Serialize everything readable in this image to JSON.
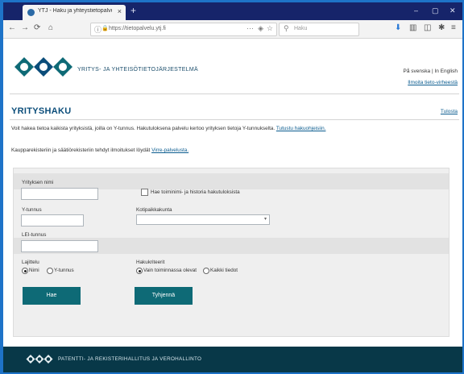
{
  "browser": {
    "tab_title": "YTJ - Haku ja yhteystietopalvelu",
    "tab_close": "×",
    "new_tab": "+",
    "window_controls": [
      "–",
      "▢",
      "✕"
    ],
    "url": "https://tietopalvelu.ytj.fi",
    "search_placeholder": "Haku",
    "nav": {
      "back": "←",
      "forward": "→",
      "reload": "⟳",
      "home": "⌂",
      "more": "···",
      "download": "⬇",
      "library": "▥",
      "sidebar": "◫",
      "menu": "≡"
    }
  },
  "header": {
    "brand": "YRITYS- JA YHTEISÖTIETOJÄRJESTELMÄ",
    "languages": "På svenska  |  In English",
    "contact_link": "Ilmoita tieto-virheestä"
  },
  "main": {
    "title": "YRITYSHAKU",
    "help_link": "Tulosta",
    "intro_text": "Voit hakea tietoa kaikista yrityksistä, joilla on Y-tunnus. Hakutuloksena palvelu kertoo yrityksen tietoja Y-tunnukselta.",
    "intro_link": "Tutustu hakuohjeisiin.",
    "trade_text": "Kaupparekisteriin ja säätiörekisteriin tehdyt ilmoitukset löydät",
    "trade_link": "Virre-palvelusta."
  },
  "form": {
    "name_label": "Yrityksen nimi",
    "name_value": "",
    "history_checkbox_label": "Hae toiminimi- ja historia hakutuloksista",
    "business_id_label": "Y-tunnus",
    "business_id_value": "",
    "municipality_label": "Kotipaikkakunta",
    "municipality_value": "",
    "lei_label": "LEI-tunnus",
    "lei_value": "",
    "type_label": "Lajittelu",
    "type_options": [
      "Nimi",
      "Y-tunnus"
    ],
    "status_label": "Hakukriteerit",
    "status_options": [
      "Vain toiminnassa olevat",
      "Kaikki tiedot"
    ],
    "search_button": "Hae",
    "clear_button": "Tyhjennä"
  },
  "footer": {
    "text": "PATENTTI- JA REKISTERIHALLITUS JA VEROHALLINTO"
  },
  "colors": {
    "accent": "#0e6a76",
    "footer": "#083848",
    "tabbar": "#16246a",
    "link": "#0b5c8f"
  }
}
